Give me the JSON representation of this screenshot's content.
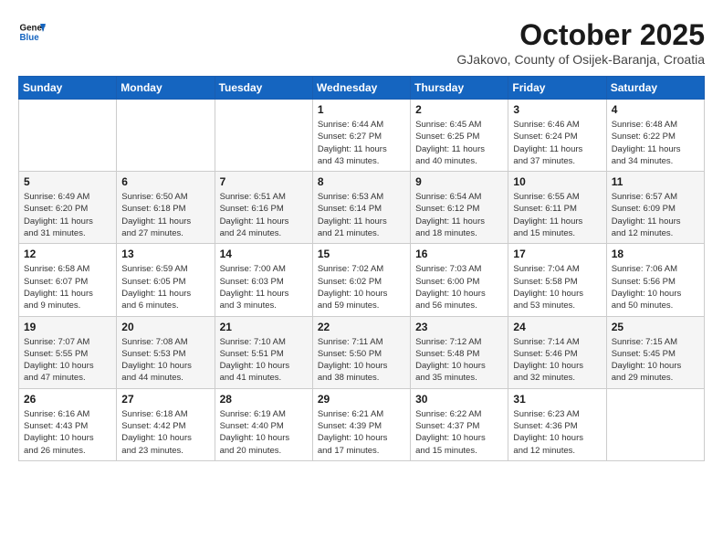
{
  "header": {
    "logo_line1": "General",
    "logo_line2": "Blue",
    "month_title": "October 2025",
    "subtitle": "GJakovo, County of Osijek-Baranja, Croatia"
  },
  "weekdays": [
    "Sunday",
    "Monday",
    "Tuesday",
    "Wednesday",
    "Thursday",
    "Friday",
    "Saturday"
  ],
  "weeks": [
    [
      {
        "day": "",
        "info": ""
      },
      {
        "day": "",
        "info": ""
      },
      {
        "day": "",
        "info": ""
      },
      {
        "day": "1",
        "info": "Sunrise: 6:44 AM\nSunset: 6:27 PM\nDaylight: 11 hours\nand 43 minutes."
      },
      {
        "day": "2",
        "info": "Sunrise: 6:45 AM\nSunset: 6:25 PM\nDaylight: 11 hours\nand 40 minutes."
      },
      {
        "day": "3",
        "info": "Sunrise: 6:46 AM\nSunset: 6:24 PM\nDaylight: 11 hours\nand 37 minutes."
      },
      {
        "day": "4",
        "info": "Sunrise: 6:48 AM\nSunset: 6:22 PM\nDaylight: 11 hours\nand 34 minutes."
      }
    ],
    [
      {
        "day": "5",
        "info": "Sunrise: 6:49 AM\nSunset: 6:20 PM\nDaylight: 11 hours\nand 31 minutes."
      },
      {
        "day": "6",
        "info": "Sunrise: 6:50 AM\nSunset: 6:18 PM\nDaylight: 11 hours\nand 27 minutes."
      },
      {
        "day": "7",
        "info": "Sunrise: 6:51 AM\nSunset: 6:16 PM\nDaylight: 11 hours\nand 24 minutes."
      },
      {
        "day": "8",
        "info": "Sunrise: 6:53 AM\nSunset: 6:14 PM\nDaylight: 11 hours\nand 21 minutes."
      },
      {
        "day": "9",
        "info": "Sunrise: 6:54 AM\nSunset: 6:12 PM\nDaylight: 11 hours\nand 18 minutes."
      },
      {
        "day": "10",
        "info": "Sunrise: 6:55 AM\nSunset: 6:11 PM\nDaylight: 11 hours\nand 15 minutes."
      },
      {
        "day": "11",
        "info": "Sunrise: 6:57 AM\nSunset: 6:09 PM\nDaylight: 11 hours\nand 12 minutes."
      }
    ],
    [
      {
        "day": "12",
        "info": "Sunrise: 6:58 AM\nSunset: 6:07 PM\nDaylight: 11 hours\nand 9 minutes."
      },
      {
        "day": "13",
        "info": "Sunrise: 6:59 AM\nSunset: 6:05 PM\nDaylight: 11 hours\nand 6 minutes."
      },
      {
        "day": "14",
        "info": "Sunrise: 7:00 AM\nSunset: 6:03 PM\nDaylight: 11 hours\nand 3 minutes."
      },
      {
        "day": "15",
        "info": "Sunrise: 7:02 AM\nSunset: 6:02 PM\nDaylight: 10 hours\nand 59 minutes."
      },
      {
        "day": "16",
        "info": "Sunrise: 7:03 AM\nSunset: 6:00 PM\nDaylight: 10 hours\nand 56 minutes."
      },
      {
        "day": "17",
        "info": "Sunrise: 7:04 AM\nSunset: 5:58 PM\nDaylight: 10 hours\nand 53 minutes."
      },
      {
        "day": "18",
        "info": "Sunrise: 7:06 AM\nSunset: 5:56 PM\nDaylight: 10 hours\nand 50 minutes."
      }
    ],
    [
      {
        "day": "19",
        "info": "Sunrise: 7:07 AM\nSunset: 5:55 PM\nDaylight: 10 hours\nand 47 minutes."
      },
      {
        "day": "20",
        "info": "Sunrise: 7:08 AM\nSunset: 5:53 PM\nDaylight: 10 hours\nand 44 minutes."
      },
      {
        "day": "21",
        "info": "Sunrise: 7:10 AM\nSunset: 5:51 PM\nDaylight: 10 hours\nand 41 minutes."
      },
      {
        "day": "22",
        "info": "Sunrise: 7:11 AM\nSunset: 5:50 PM\nDaylight: 10 hours\nand 38 minutes."
      },
      {
        "day": "23",
        "info": "Sunrise: 7:12 AM\nSunset: 5:48 PM\nDaylight: 10 hours\nand 35 minutes."
      },
      {
        "day": "24",
        "info": "Sunrise: 7:14 AM\nSunset: 5:46 PM\nDaylight: 10 hours\nand 32 minutes."
      },
      {
        "day": "25",
        "info": "Sunrise: 7:15 AM\nSunset: 5:45 PM\nDaylight: 10 hours\nand 29 minutes."
      }
    ],
    [
      {
        "day": "26",
        "info": "Sunrise: 6:16 AM\nSunset: 4:43 PM\nDaylight: 10 hours\nand 26 minutes."
      },
      {
        "day": "27",
        "info": "Sunrise: 6:18 AM\nSunset: 4:42 PM\nDaylight: 10 hours\nand 23 minutes."
      },
      {
        "day": "28",
        "info": "Sunrise: 6:19 AM\nSunset: 4:40 PM\nDaylight: 10 hours\nand 20 minutes."
      },
      {
        "day": "29",
        "info": "Sunrise: 6:21 AM\nSunset: 4:39 PM\nDaylight: 10 hours\nand 17 minutes."
      },
      {
        "day": "30",
        "info": "Sunrise: 6:22 AM\nSunset: 4:37 PM\nDaylight: 10 hours\nand 15 minutes."
      },
      {
        "day": "31",
        "info": "Sunrise: 6:23 AM\nSunset: 4:36 PM\nDaylight: 10 hours\nand 12 minutes."
      },
      {
        "day": "",
        "info": ""
      }
    ]
  ]
}
